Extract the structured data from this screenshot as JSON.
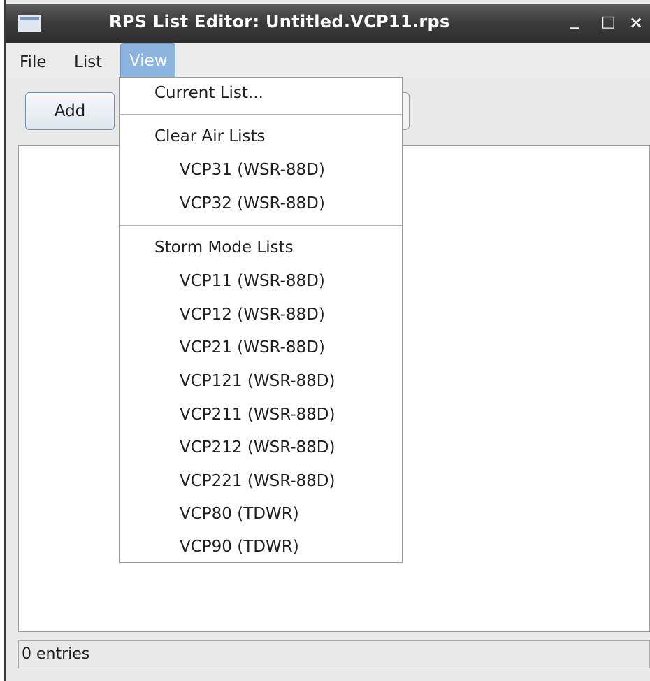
{
  "window": {
    "title": "RPS List Editor: Untitled.VCP11.rps",
    "min_glyph": "_",
    "max_glyph": "□",
    "close_glyph": "×"
  },
  "menubar": {
    "file": "File",
    "list": "List",
    "view": "View"
  },
  "toolbar": {
    "add_label": "Add"
  },
  "view_menu": {
    "current_list": "Current List...",
    "clear_air_header": "Clear Air Lists",
    "clear_air_items": [
      "VCP31 (WSR-88D)",
      "VCP32 (WSR-88D)"
    ],
    "storm_mode_header": "Storm Mode Lists",
    "storm_mode_items": [
      "VCP11 (WSR-88D)",
      "VCP12 (WSR-88D)",
      "VCP21 (WSR-88D)",
      "VCP121 (WSR-88D)",
      "VCP211 (WSR-88D)",
      "VCP212 (WSR-88D)",
      "VCP221 (WSR-88D)",
      "VCP80 (TDWR)",
      "VCP90 (TDWR)"
    ]
  },
  "status": {
    "text": "0 entries"
  },
  "colors": {
    "menu_highlight": "#8cb4df",
    "titlebar": "#3c3c3c"
  }
}
